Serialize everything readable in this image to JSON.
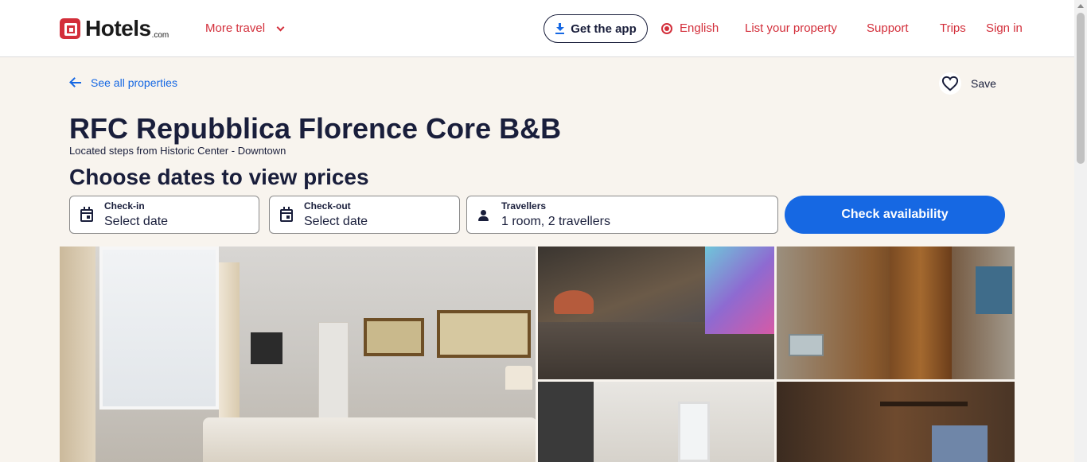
{
  "header": {
    "logo_text": "Hotels",
    "logo_sub": ".com",
    "more_travel": "More travel",
    "get_app": "Get the app",
    "language": "English",
    "list_property": "List your property",
    "support": "Support",
    "trips": "Trips",
    "sign_in": "Sign in"
  },
  "nav": {
    "back_label": "See all properties",
    "save_label": "Save"
  },
  "property": {
    "name": "RFC Repubblica Florence Core B&B",
    "tagline": "Located steps from Historic Center - Downtown"
  },
  "search": {
    "heading": "Choose dates to view prices",
    "checkin_label": "Check-in",
    "checkin_value": "Select date",
    "checkout_label": "Check-out",
    "checkout_value": "Select date",
    "travellers_label": "Travellers",
    "travellers_value": "1 room, 2 travellers",
    "submit": "Check availability"
  },
  "colors": {
    "brand_red": "#d32f3b",
    "link_blue": "#1668e3",
    "page_bg": "#f8f4ee",
    "text": "#191e3b"
  }
}
